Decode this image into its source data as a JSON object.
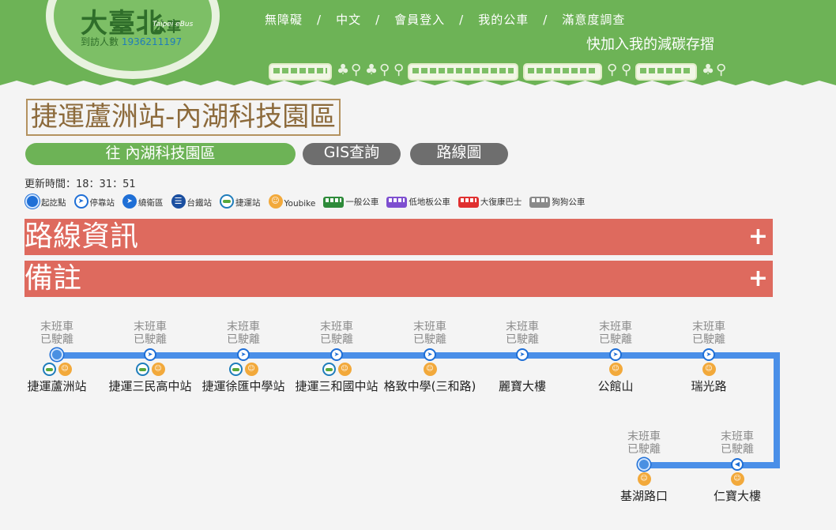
{
  "header": {
    "logo_title": "大臺北",
    "logo_sub": "公車",
    "logo_en": "Taipei eBus",
    "visits_label": "到訪人數",
    "visits_count": "1936211197",
    "nav": [
      "無障礙",
      "中文",
      "會員登入",
      "我的公車",
      "滿意度調查"
    ],
    "slogan": "快加入我的減碳存摺"
  },
  "route": {
    "title": "捷運蘆洲站-內湖科技園區",
    "direction_tab": "往 內湖科技園區",
    "gis_tab": "GIS查詢",
    "map_tab": "路線圖",
    "update_label": "更新時間：",
    "update_time": "18：31：51"
  },
  "legend": [
    {
      "icon": "start-point-icon",
      "label": "起訖點"
    },
    {
      "icon": "stop-icon",
      "label": "停靠站"
    },
    {
      "icon": "ring-icon",
      "label": "繞衛區"
    },
    {
      "icon": "rail-icon",
      "label": "台鐵站"
    },
    {
      "icon": "mrt-icon",
      "label": "捷運站"
    },
    {
      "icon": "youbike-icon",
      "label": "Youbike"
    },
    {
      "icon": "general-bus-icon",
      "label": "一般公車"
    },
    {
      "icon": "low-floor-bus-icon",
      "label": "低地板公車"
    },
    {
      "icon": "rehab-bus-icon",
      "label": "大復康巴士"
    },
    {
      "icon": "dog-bus-icon",
      "label": "狗狗公車"
    }
  ],
  "sections": {
    "route_info": "路線資訊",
    "notes": "備註",
    "expand_symbol": "+"
  },
  "stops_row1": [
    {
      "status1": "末班車",
      "status2": "已駛離",
      "name": "捷運蘆洲站",
      "mrt": true,
      "youbike": true,
      "type": "start"
    },
    {
      "status1": "末班車",
      "status2": "已駛離",
      "name": "捷運三民高中站",
      "mrt": true,
      "youbike": true,
      "type": "stop"
    },
    {
      "status1": "末班車",
      "status2": "已駛離",
      "name": "捷運徐匯中學站",
      "mrt": true,
      "youbike": true,
      "type": "stop"
    },
    {
      "status1": "末班車",
      "status2": "已駛離",
      "name": "捷運三和國中站",
      "mrt": true,
      "youbike": true,
      "type": "stop"
    },
    {
      "status1": "末班車",
      "status2": "已駛離",
      "name": "格致中學(三和路)",
      "mrt": false,
      "youbike": true,
      "type": "stop"
    },
    {
      "status1": "末班車",
      "status2": "已駛離",
      "name": "麗寶大樓",
      "mrt": false,
      "youbike": false,
      "type": "stop"
    },
    {
      "status1": "末班車",
      "status2": "已駛離",
      "name": "公館山",
      "mrt": false,
      "youbike": true,
      "type": "stop"
    },
    {
      "status1": "末班車",
      "status2": "已駛離",
      "name": "瑞光路",
      "mrt": false,
      "youbike": true,
      "type": "stop"
    }
  ],
  "stops_row2": [
    {
      "status1": "末班車",
      "status2": "已駛離",
      "name": "基湖路口",
      "mrt": false,
      "youbike": true,
      "type": "start"
    },
    {
      "status1": "末班車",
      "status2": "已駛離",
      "name": "仁寶大樓",
      "mrt": false,
      "youbike": true,
      "type": "stop-reverse"
    }
  ],
  "colors": {
    "header_green": "#6db356",
    "accordion_red": "#de6a5e",
    "route_line": "#4a8fe8",
    "title_brown": "#8c6a3b"
  }
}
